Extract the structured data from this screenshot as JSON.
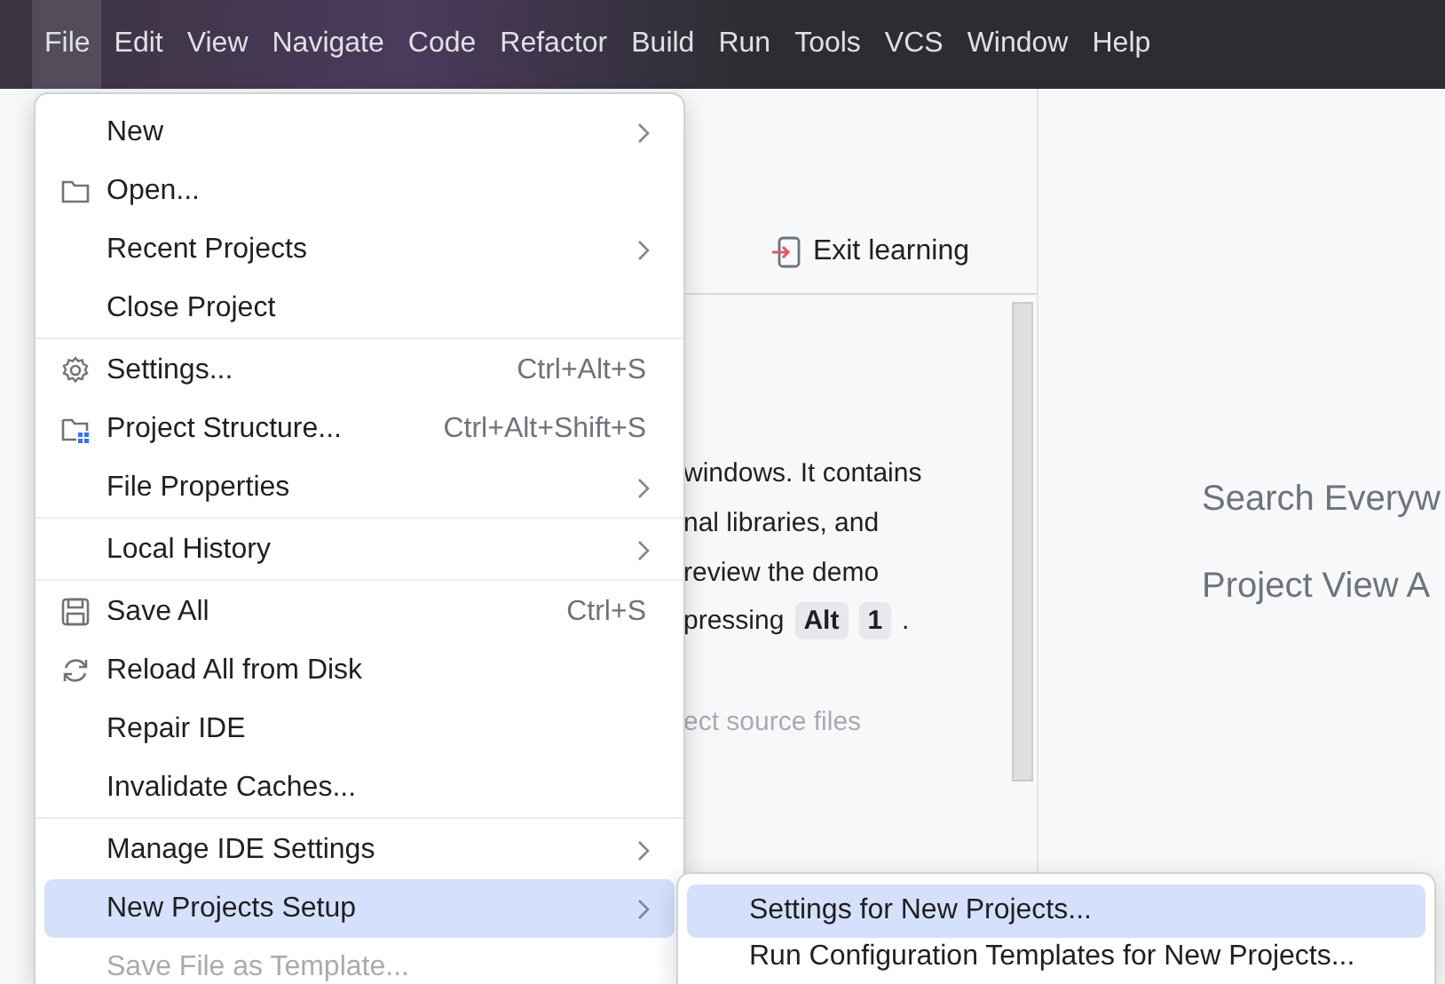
{
  "menubar": {
    "items": [
      {
        "label": "File",
        "selected": true
      },
      {
        "label": "Edit",
        "selected": false
      },
      {
        "label": "View",
        "selected": false
      },
      {
        "label": "Navigate",
        "selected": false
      },
      {
        "label": "Code",
        "selected": false
      },
      {
        "label": "Refactor",
        "selected": false
      },
      {
        "label": "Build",
        "selected": false
      },
      {
        "label": "Run",
        "selected": false
      },
      {
        "label": "Tools",
        "selected": false
      },
      {
        "label": "VCS",
        "selected": false
      },
      {
        "label": "Window",
        "selected": false
      },
      {
        "label": "Help",
        "selected": false
      }
    ]
  },
  "learning_panel": {
    "exit_button": "Exit learning",
    "lines": [
      {
        "kind": "text",
        "parts": [
          {
            "kind": "text",
            "text": "windows. It contains"
          }
        ]
      },
      {
        "kind": "text",
        "parts": [
          {
            "kind": "text",
            "text": "nal libraries, and"
          }
        ]
      },
      {
        "kind": "text",
        "parts": [
          {
            "kind": "text",
            "text": "review the demo"
          }
        ]
      },
      {
        "kind": "text",
        "parts": [
          {
            "kind": "text",
            "text": "pressing"
          },
          {
            "kind": "key",
            "text": "Alt"
          },
          {
            "kind": "key",
            "text": "1"
          },
          {
            "kind": "text",
            "text": "."
          }
        ]
      },
      {
        "kind": "hint",
        "parts": [
          {
            "kind": "text",
            "text": "ect source files"
          }
        ]
      }
    ]
  },
  "welcome_hints": [
    "Search Everyw",
    "Project View A"
  ],
  "file_menu": {
    "items": [
      {
        "kind": "item",
        "label": "New",
        "submenu": true,
        "selected": false,
        "disabled": false
      },
      {
        "kind": "folder",
        "label": "Open...",
        "submenu": false,
        "selected": false,
        "disabled": false
      },
      {
        "kind": "item",
        "label": "Recent Projects",
        "submenu": true,
        "selected": false,
        "disabled": false
      },
      {
        "kind": "item",
        "label": "Close Project",
        "submenu": false,
        "selected": false,
        "disabled": false
      },
      {
        "kind": "separator"
      },
      {
        "kind": "gear",
        "label": "Settings...",
        "shortcut": "Ctrl+Alt+S",
        "submenu": false,
        "selected": false,
        "disabled": false
      },
      {
        "kind": "structure",
        "label": "Project Structure...",
        "shortcut": "Ctrl+Alt+Shift+S",
        "submenu": false,
        "selected": false,
        "disabled": false
      },
      {
        "kind": "item",
        "label": "File Properties",
        "submenu": true,
        "selected": false,
        "disabled": false
      },
      {
        "kind": "separator"
      },
      {
        "kind": "item",
        "label": "Local History",
        "submenu": true,
        "selected": false,
        "disabled": false
      },
      {
        "kind": "separator"
      },
      {
        "kind": "save",
        "label": "Save All",
        "shortcut": "Ctrl+S",
        "submenu": false,
        "selected": false,
        "disabled": false
      },
      {
        "kind": "reload",
        "label": "Reload All from Disk",
        "submenu": false,
        "selected": false,
        "disabled": false
      },
      {
        "kind": "item",
        "label": "Repair IDE",
        "submenu": false,
        "selected": false,
        "disabled": false
      },
      {
        "kind": "item",
        "label": "Invalidate Caches...",
        "submenu": false,
        "selected": false,
        "disabled": false
      },
      {
        "kind": "separator"
      },
      {
        "kind": "item",
        "label": "Manage IDE Settings",
        "submenu": true,
        "selected": false,
        "disabled": false
      },
      {
        "kind": "item",
        "label": "New Projects Setup",
        "submenu": true,
        "selected": true,
        "disabled": false
      },
      {
        "kind": "item",
        "label": "Save File as Template...",
        "submenu": false,
        "selected": false,
        "disabled": true
      }
    ]
  },
  "submenu": {
    "items": [
      {
        "kind": "item",
        "label": "Settings for New Projects...",
        "selected": true
      },
      {
        "kind": "item",
        "label": "Run Configuration Templates for New Projects...",
        "selected": false
      }
    ]
  }
}
